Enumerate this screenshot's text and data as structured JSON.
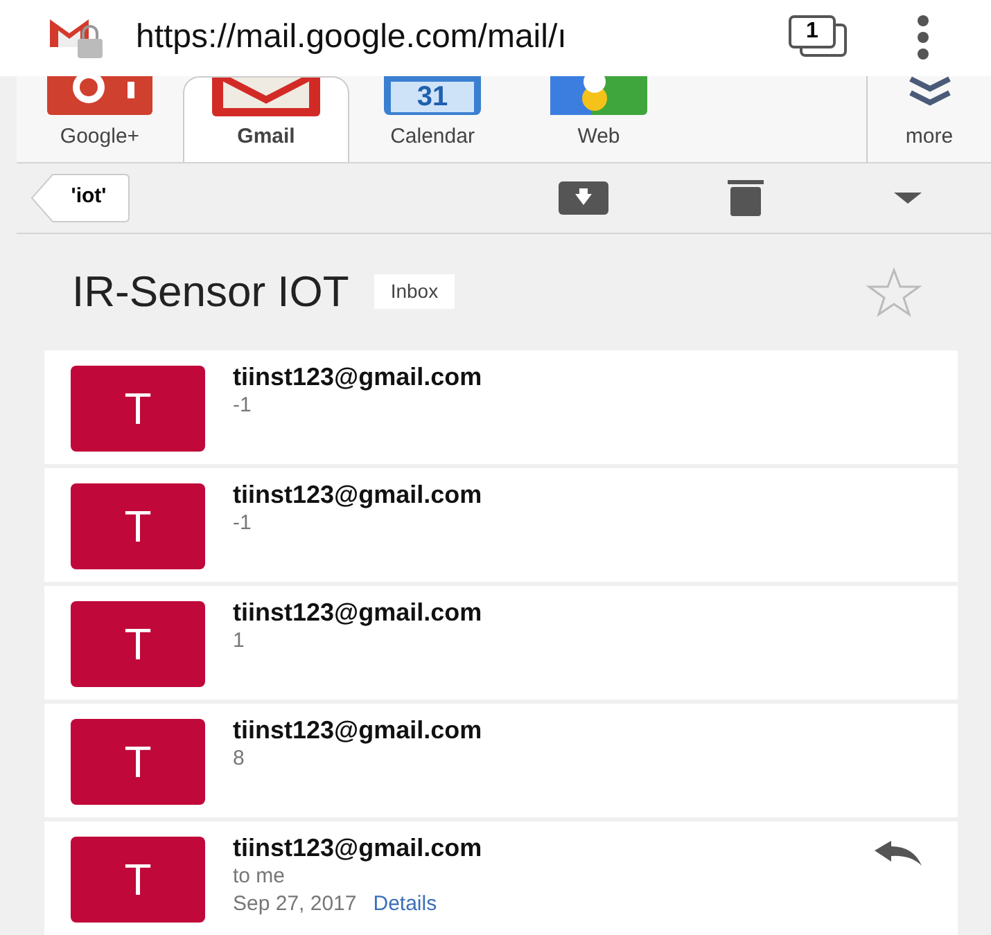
{
  "browser": {
    "url": "https://mail.google.com/mail/ı",
    "tab_count": "1"
  },
  "apps": [
    {
      "label": "Google+",
      "selected": false,
      "kind": "gplus"
    },
    {
      "label": "Gmail",
      "selected": true,
      "kind": "gmail"
    },
    {
      "label": "Calendar",
      "selected": false,
      "kind": "calendar",
      "icon_text": "31"
    },
    {
      "label": "Web",
      "selected": false,
      "kind": "web"
    },
    {
      "label": "more",
      "selected": false,
      "kind": "more"
    }
  ],
  "back_label": "'iot'",
  "thread": {
    "subject": "IR-Sensor IOT",
    "label": "Inbox",
    "starred": false
  },
  "messages": [
    {
      "kind": "collapsed",
      "initial": "T",
      "sender": "tiinst123@gmail.com",
      "snippet": "-1"
    },
    {
      "kind": "collapsed",
      "initial": "T",
      "sender": "tiinst123@gmail.com",
      "snippet": "-1"
    },
    {
      "kind": "collapsed",
      "initial": "T",
      "sender": "tiinst123@gmail.com",
      "snippet": "1"
    },
    {
      "kind": "collapsed",
      "initial": "T",
      "sender": "tiinst123@gmail.com",
      "snippet": "8"
    },
    {
      "kind": "expanded",
      "initial": "T",
      "sender": "tiinst123@gmail.com",
      "recipient": "to me",
      "date": "Sep 27, 2017",
      "details_link": "Details"
    }
  ]
}
